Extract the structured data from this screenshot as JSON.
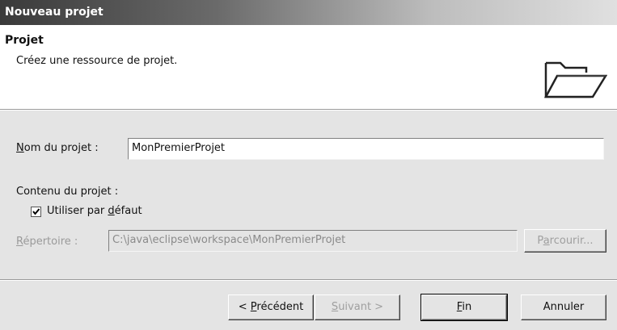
{
  "window": {
    "title": "Nouveau projet"
  },
  "banner": {
    "title": "Projet",
    "description": "Créez une ressource de projet.",
    "icon": "folder-icon"
  },
  "form": {
    "project_name": {
      "label_accel": "N",
      "label_rest": "om du projet :",
      "value": "MonPremierProjet"
    },
    "content_section": {
      "label": "Contenu du projet :"
    },
    "use_default": {
      "checked": true,
      "label_before": "Utiliser par ",
      "label_accel": "d",
      "label_after": "éfaut"
    },
    "directory": {
      "label_accel": "R",
      "label_rest": "épertoire :",
      "value": "C:\\java\\eclipse\\workspace\\MonPremierProjet",
      "browse_accel": "a",
      "browse_before": "P",
      "browse_after": "rcourir..."
    }
  },
  "buttons": {
    "back": {
      "before": "< ",
      "accel": "P",
      "after": "récédent"
    },
    "next": {
      "accel": "S",
      "after": "uivant >"
    },
    "finish": {
      "accel": "F",
      "after": "in"
    },
    "cancel": {
      "label": "Annuler"
    }
  }
}
